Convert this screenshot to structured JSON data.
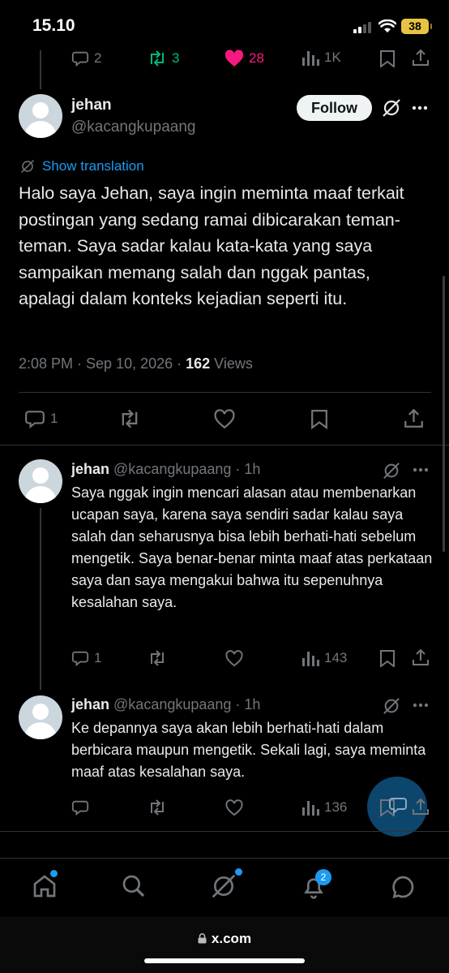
{
  "status_bar": {
    "time": "15.10",
    "battery": "38"
  },
  "prev_tweet_actions": {
    "replies": "2",
    "retweets": "3",
    "likes": "28",
    "views": "1K"
  },
  "main_tweet": {
    "name": "jehan",
    "handle": "@kacangkupaang",
    "follow_label": "Follow",
    "show_translation": "Show translation",
    "text": "Halo saya Jehan, saya ingin meminta maaf terkait postingan yang sedang ramai dibicarakan teman-teman. Saya sadar kalau kata-kata yang saya sampaikan memang salah dan nggak pantas, apalagi dalam konteks kejadian seperti itu.",
    "timestamp": "2:08 PM · Sep 10, 2026 · ",
    "views_count": "162",
    "views_label": " Views",
    "replies": "1"
  },
  "replies": [
    {
      "name": "jehan",
      "meta": "@kacangkupaang · 1h",
      "text": "Saya nggak ingin mencari alasan atau membenarkan ucapan saya, karena saya sendiri sadar kalau saya salah dan seharusnya bisa lebih berhati-hati sebelum mengetik. Saya benar-benar minta maaf atas perkataan saya dan saya mengakui bahwa itu sepenuhnya kesalahan saya.",
      "replies": "1",
      "views": "143"
    },
    {
      "name": "jehan",
      "meta": "@kacangkupaang · 1h",
      "text": "Ke depannya saya akan lebih berhati-hati dalam berbicara maupun mengetik. Sekali lagi, saya meminta maaf atas kesalahan saya.",
      "replies": "",
      "views": "136"
    }
  ],
  "tab_bar": {
    "notifications_badge": "2"
  },
  "url_bar": {
    "url": "x.com"
  },
  "colors": {
    "accent": "#1d9bf0",
    "like": "#f91880",
    "retweet": "#00ba7c",
    "follow_bg": "#eff3f4"
  },
  "icons": [
    "reply-icon",
    "retweet-icon",
    "like-icon",
    "views-icon",
    "bookmark-icon",
    "share-icon",
    "grok-icon",
    "more-icon",
    "home-icon",
    "search-icon",
    "notifications-icon",
    "messages-icon",
    "lock-icon"
  ]
}
